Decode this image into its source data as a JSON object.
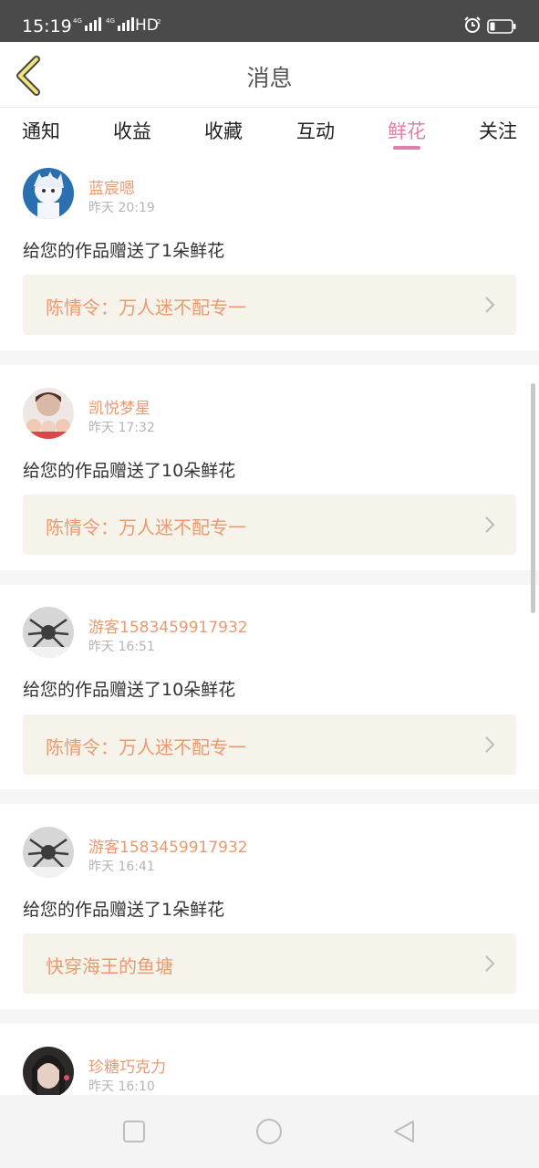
{
  "status_bar": {
    "time": "15:19",
    "network1": "4G",
    "network2": "4G",
    "hd_label": "HD",
    "hd_sub": "2",
    "icons": [
      "signal-icon",
      "alarm-icon",
      "battery-icon"
    ]
  },
  "nav": {
    "title": "消息",
    "back_icon": "chevron-left-icon"
  },
  "tabs": [
    {
      "label": "通知",
      "active": false
    },
    {
      "label": "收益",
      "active": false
    },
    {
      "label": "收藏",
      "active": false
    },
    {
      "label": "互动",
      "active": false
    },
    {
      "label": "鲜花",
      "active": true
    },
    {
      "label": "关注",
      "active": false
    }
  ],
  "colors": {
    "accent": "#e27ea7",
    "username": "#ea9a70",
    "link_bg": "#f5f3ea",
    "muted": "#b5b5b5"
  },
  "messages": [
    {
      "user": "蓝宸嗯",
      "time": "昨天 20:19",
      "text": "给您的作品赠送了1朵鲜花",
      "work": "陈情令：万人迷不配专一"
    },
    {
      "user": "凯悦梦星",
      "time": "昨天 17:32",
      "text": "给您的作品赠送了10朵鲜花",
      "work": "陈情令：万人迷不配专一"
    },
    {
      "user": "游客1583459917932",
      "time": "昨天 16:51",
      "text": "给您的作品赠送了10朵鲜花",
      "work": "陈情令：万人迷不配专一"
    },
    {
      "user": "游客1583459917932",
      "time": "昨天 16:41",
      "text": "给您的作品赠送了1朵鲜花",
      "work": "快穿海王的鱼塘"
    },
    {
      "user": "珍糖巧克力",
      "time": "昨天 16:10"
    }
  ],
  "system_nav": {
    "icons": [
      "recent-apps-icon",
      "home-icon",
      "back-icon"
    ]
  }
}
